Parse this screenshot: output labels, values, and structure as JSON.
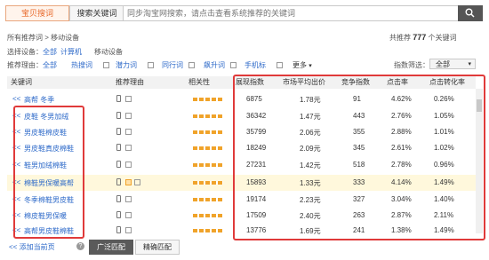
{
  "tabs": [
    "宝贝搜词",
    "搜索关键词"
  ],
  "search": {
    "placeholder": "同步淘宝网搜索，请点击查看系统推荐的关键词"
  },
  "breadcrumb": {
    "root": "所有推荐词",
    "sep": ">",
    "current": "移动设备"
  },
  "result_count": {
    "prefix": "共推荐",
    "count": "777",
    "suffix": "个关键词"
  },
  "filters": {
    "device_label": "选择设备：",
    "devices": [
      "全部",
      "计算机",
      "移动设备"
    ],
    "reason_label": "推荐理由：",
    "reasons": [
      "全部",
      "热搜词",
      "潜力词",
      "同行词",
      "飙升词",
      "手机标"
    ],
    "more": "更多",
    "metric_label": "指数筛选：",
    "metric_value": "全部"
  },
  "columns": [
    "关键词",
    "推荐理由",
    "相关性",
    "展现指数",
    "市场平均出价",
    "竞争指数",
    "点击率",
    "点击转化率"
  ],
  "rows": [
    {
      "kw": "高帮 冬季",
      "imp": "6875",
      "bid": "1.78元",
      "comp": "91",
      "ctr": "4.62%",
      "cvr": "0.26%"
    },
    {
      "kw": "皮鞋 冬男加绒",
      "imp": "36342",
      "bid": "1.47元",
      "comp": "443",
      "ctr": "2.76%",
      "cvr": "1.05%"
    },
    {
      "kw": "男皮鞋棉皮鞋",
      "imp": "35799",
      "bid": "2.06元",
      "comp": "355",
      "ctr": "2.88%",
      "cvr": "1.01%"
    },
    {
      "kw": "男皮鞋真皮棉鞋",
      "imp": "18249",
      "bid": "2.09元",
      "comp": "345",
      "ctr": "2.61%",
      "cvr": "1.02%"
    },
    {
      "kw": "鞋男加绒棉鞋",
      "imp": "27231",
      "bid": "1.42元",
      "comp": "518",
      "ctr": "2.78%",
      "cvr": "0.96%"
    },
    {
      "kw": "棉鞋男保暖高帮",
      "imp": "15893",
      "bid": "1.33元",
      "comp": "333",
      "ctr": "4.14%",
      "cvr": "1.49%"
    },
    {
      "kw": "冬季棉鞋男皮鞋",
      "imp": "19174",
      "bid": "2.23元",
      "comp": "327",
      "ctr": "3.04%",
      "cvr": "1.40%"
    },
    {
      "kw": "棉皮鞋男保暖",
      "imp": "17509",
      "bid": "2.40元",
      "comp": "263",
      "ctr": "2.87%",
      "cvr": "2.11%"
    },
    {
      "kw": "高帮男皮鞋棉鞋",
      "imp": "13776",
      "bid": "1.69元",
      "comp": "241",
      "ctr": "1.38%",
      "cvr": "1.49%"
    }
  ],
  "row_prefix": "<<",
  "footer": {
    "add_link": "添加当前页",
    "broad": "广泛匹配",
    "exact": "精确匹配"
  },
  "colors": {
    "accent": "#e8692a",
    "link": "#2e6ac9",
    "highlight": "#e03a3a"
  }
}
